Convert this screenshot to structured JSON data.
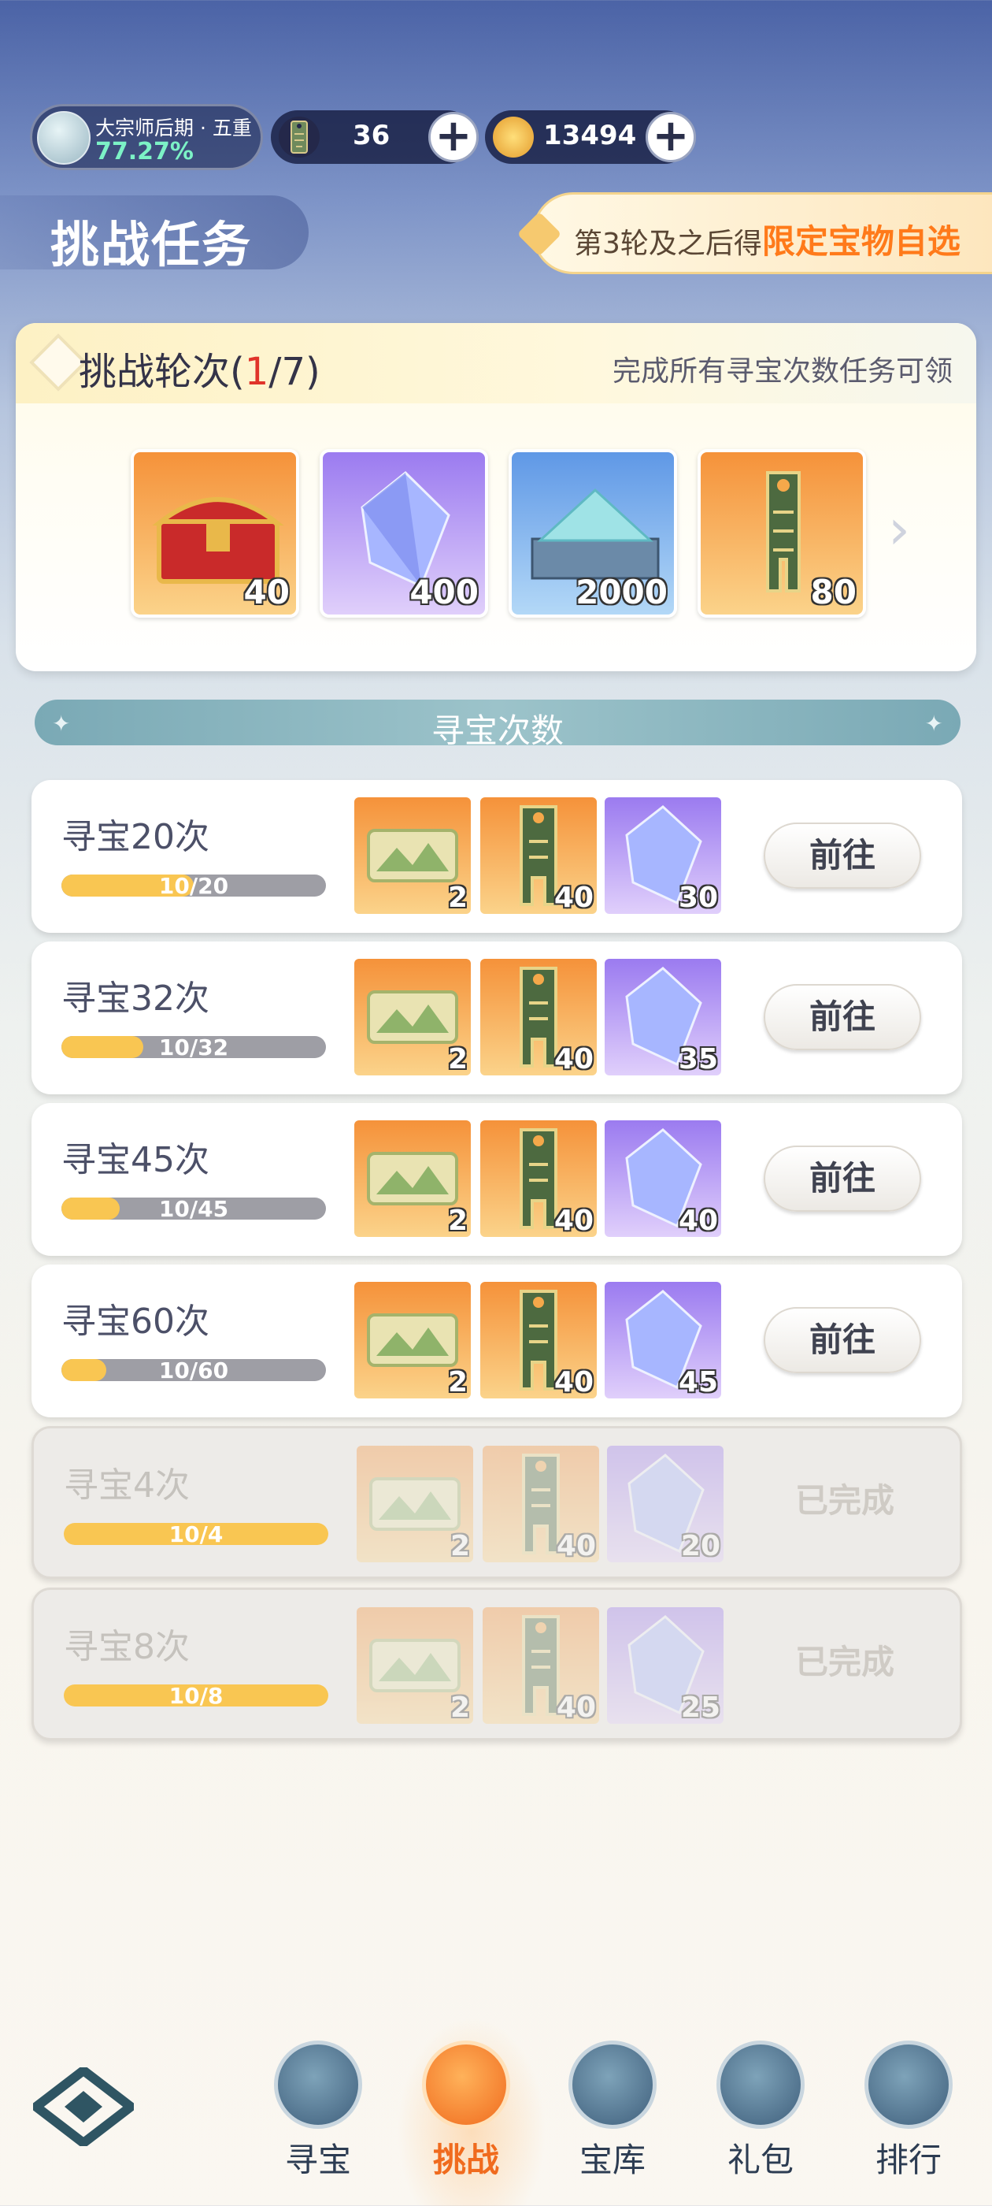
{
  "top": {
    "rank_label": "大宗师后期 · 五重",
    "rank_percent": "77.27%",
    "currency1": {
      "value": "36",
      "icon": "token-icon"
    },
    "currency2": {
      "value": "13494",
      "icon": "coin-icon"
    },
    "plus_label": "+"
  },
  "page_title": "挑战任务",
  "banner": {
    "prefix": "第3轮及之后得",
    "highlight": "限定宝物自选"
  },
  "round_panel": {
    "label_prefix": "挑战轮次(",
    "current": "1",
    "label_suffix": "/7)",
    "note": "完成所有寻宝次数任务可领",
    "rewards": [
      {
        "icon": "treasure-chest-icon",
        "qty": "40"
      },
      {
        "icon": "crystal-icon",
        "qty": "400"
      },
      {
        "icon": "jade-stone-icon",
        "qty": "2000"
      },
      {
        "icon": "token-icon",
        "qty": "80"
      }
    ]
  },
  "section_title": "寻宝次数",
  "tasks": [
    {
      "name": "寻宝20次",
      "progress": "10/20",
      "fraction": 0.5,
      "rewards": [
        "2",
        "40",
        "30"
      ],
      "action": "前往",
      "done": false
    },
    {
      "name": "寻宝32次",
      "progress": "10/32",
      "fraction": 0.3125,
      "rewards": [
        "2",
        "40",
        "35"
      ],
      "action": "前往",
      "done": false
    },
    {
      "name": "寻宝45次",
      "progress": "10/45",
      "fraction": 0.222,
      "rewards": [
        "2",
        "40",
        "40"
      ],
      "action": "前往",
      "done": false
    },
    {
      "name": "寻宝60次",
      "progress": "10/60",
      "fraction": 0.167,
      "rewards": [
        "2",
        "40",
        "45"
      ],
      "action": "前往",
      "done": false
    },
    {
      "name": "寻宝4次",
      "progress": "10/4",
      "fraction": 1.0,
      "rewards": [
        "2",
        "40",
        "20"
      ],
      "action": "已完成",
      "done": true
    },
    {
      "name": "寻宝8次",
      "progress": "10/8",
      "fraction": 1.0,
      "rewards": [
        "2",
        "40",
        "25"
      ],
      "action": "已完成",
      "done": true
    }
  ],
  "nav": [
    {
      "label": "寻宝",
      "icon": "treasure-bag-icon",
      "active": false
    },
    {
      "label": "挑战",
      "icon": "scroll-icon",
      "active": true
    },
    {
      "label": "宝库",
      "icon": "vault-icon",
      "active": false
    },
    {
      "label": "礼包",
      "icon": "gift-icon",
      "active": false
    },
    {
      "label": "排行",
      "icon": "rank-icon",
      "active": false
    }
  ],
  "colors": {
    "accent": "#f06b1e",
    "highlight": "#ff7a1a",
    "progress": "#f9c652"
  }
}
